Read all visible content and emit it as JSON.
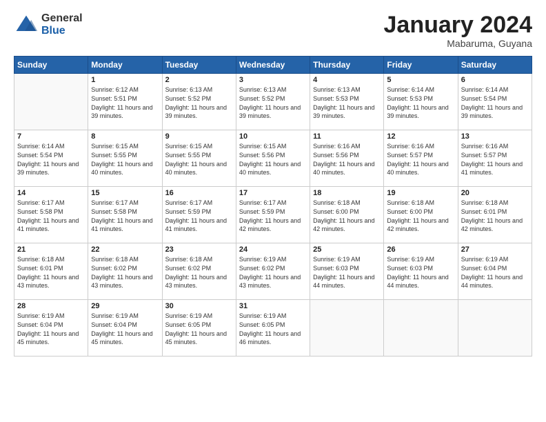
{
  "header": {
    "logo_general": "General",
    "logo_blue": "Blue",
    "month_title": "January 2024",
    "location": "Mabaruma, Guyana"
  },
  "days_of_week": [
    "Sunday",
    "Monday",
    "Tuesday",
    "Wednesday",
    "Thursday",
    "Friday",
    "Saturday"
  ],
  "weeks": [
    [
      {
        "day": "",
        "sunrise": "",
        "sunset": "",
        "daylight": ""
      },
      {
        "day": "1",
        "sunrise": "Sunrise: 6:12 AM",
        "sunset": "Sunset: 5:51 PM",
        "daylight": "Daylight: 11 hours and 39 minutes."
      },
      {
        "day": "2",
        "sunrise": "Sunrise: 6:13 AM",
        "sunset": "Sunset: 5:52 PM",
        "daylight": "Daylight: 11 hours and 39 minutes."
      },
      {
        "day": "3",
        "sunrise": "Sunrise: 6:13 AM",
        "sunset": "Sunset: 5:52 PM",
        "daylight": "Daylight: 11 hours and 39 minutes."
      },
      {
        "day": "4",
        "sunrise": "Sunrise: 6:13 AM",
        "sunset": "Sunset: 5:53 PM",
        "daylight": "Daylight: 11 hours and 39 minutes."
      },
      {
        "day": "5",
        "sunrise": "Sunrise: 6:14 AM",
        "sunset": "Sunset: 5:53 PM",
        "daylight": "Daylight: 11 hours and 39 minutes."
      },
      {
        "day": "6",
        "sunrise": "Sunrise: 6:14 AM",
        "sunset": "Sunset: 5:54 PM",
        "daylight": "Daylight: 11 hours and 39 minutes."
      }
    ],
    [
      {
        "day": "7",
        "sunrise": "Sunrise: 6:14 AM",
        "sunset": "Sunset: 5:54 PM",
        "daylight": "Daylight: 11 hours and 39 minutes."
      },
      {
        "day": "8",
        "sunrise": "Sunrise: 6:15 AM",
        "sunset": "Sunset: 5:55 PM",
        "daylight": "Daylight: 11 hours and 40 minutes."
      },
      {
        "day": "9",
        "sunrise": "Sunrise: 6:15 AM",
        "sunset": "Sunset: 5:55 PM",
        "daylight": "Daylight: 11 hours and 40 minutes."
      },
      {
        "day": "10",
        "sunrise": "Sunrise: 6:15 AM",
        "sunset": "Sunset: 5:56 PM",
        "daylight": "Daylight: 11 hours and 40 minutes."
      },
      {
        "day": "11",
        "sunrise": "Sunrise: 6:16 AM",
        "sunset": "Sunset: 5:56 PM",
        "daylight": "Daylight: 11 hours and 40 minutes."
      },
      {
        "day": "12",
        "sunrise": "Sunrise: 6:16 AM",
        "sunset": "Sunset: 5:57 PM",
        "daylight": "Daylight: 11 hours and 40 minutes."
      },
      {
        "day": "13",
        "sunrise": "Sunrise: 6:16 AM",
        "sunset": "Sunset: 5:57 PM",
        "daylight": "Daylight: 11 hours and 41 minutes."
      }
    ],
    [
      {
        "day": "14",
        "sunrise": "Sunrise: 6:17 AM",
        "sunset": "Sunset: 5:58 PM",
        "daylight": "Daylight: 11 hours and 41 minutes."
      },
      {
        "day": "15",
        "sunrise": "Sunrise: 6:17 AM",
        "sunset": "Sunset: 5:58 PM",
        "daylight": "Daylight: 11 hours and 41 minutes."
      },
      {
        "day": "16",
        "sunrise": "Sunrise: 6:17 AM",
        "sunset": "Sunset: 5:59 PM",
        "daylight": "Daylight: 11 hours and 41 minutes."
      },
      {
        "day": "17",
        "sunrise": "Sunrise: 6:17 AM",
        "sunset": "Sunset: 5:59 PM",
        "daylight": "Daylight: 11 hours and 42 minutes."
      },
      {
        "day": "18",
        "sunrise": "Sunrise: 6:18 AM",
        "sunset": "Sunset: 6:00 PM",
        "daylight": "Daylight: 11 hours and 42 minutes."
      },
      {
        "day": "19",
        "sunrise": "Sunrise: 6:18 AM",
        "sunset": "Sunset: 6:00 PM",
        "daylight": "Daylight: 11 hours and 42 minutes."
      },
      {
        "day": "20",
        "sunrise": "Sunrise: 6:18 AM",
        "sunset": "Sunset: 6:01 PM",
        "daylight": "Daylight: 11 hours and 42 minutes."
      }
    ],
    [
      {
        "day": "21",
        "sunrise": "Sunrise: 6:18 AM",
        "sunset": "Sunset: 6:01 PM",
        "daylight": "Daylight: 11 hours and 43 minutes."
      },
      {
        "day": "22",
        "sunrise": "Sunrise: 6:18 AM",
        "sunset": "Sunset: 6:02 PM",
        "daylight": "Daylight: 11 hours and 43 minutes."
      },
      {
        "day": "23",
        "sunrise": "Sunrise: 6:18 AM",
        "sunset": "Sunset: 6:02 PM",
        "daylight": "Daylight: 11 hours and 43 minutes."
      },
      {
        "day": "24",
        "sunrise": "Sunrise: 6:19 AM",
        "sunset": "Sunset: 6:02 PM",
        "daylight": "Daylight: 11 hours and 43 minutes."
      },
      {
        "day": "25",
        "sunrise": "Sunrise: 6:19 AM",
        "sunset": "Sunset: 6:03 PM",
        "daylight": "Daylight: 11 hours and 44 minutes."
      },
      {
        "day": "26",
        "sunrise": "Sunrise: 6:19 AM",
        "sunset": "Sunset: 6:03 PM",
        "daylight": "Daylight: 11 hours and 44 minutes."
      },
      {
        "day": "27",
        "sunrise": "Sunrise: 6:19 AM",
        "sunset": "Sunset: 6:04 PM",
        "daylight": "Daylight: 11 hours and 44 minutes."
      }
    ],
    [
      {
        "day": "28",
        "sunrise": "Sunrise: 6:19 AM",
        "sunset": "Sunset: 6:04 PM",
        "daylight": "Daylight: 11 hours and 45 minutes."
      },
      {
        "day": "29",
        "sunrise": "Sunrise: 6:19 AM",
        "sunset": "Sunset: 6:04 PM",
        "daylight": "Daylight: 11 hours and 45 minutes."
      },
      {
        "day": "30",
        "sunrise": "Sunrise: 6:19 AM",
        "sunset": "Sunset: 6:05 PM",
        "daylight": "Daylight: 11 hours and 45 minutes."
      },
      {
        "day": "31",
        "sunrise": "Sunrise: 6:19 AM",
        "sunset": "Sunset: 6:05 PM",
        "daylight": "Daylight: 11 hours and 46 minutes."
      },
      {
        "day": "",
        "sunrise": "",
        "sunset": "",
        "daylight": ""
      },
      {
        "day": "",
        "sunrise": "",
        "sunset": "",
        "daylight": ""
      },
      {
        "day": "",
        "sunrise": "",
        "sunset": "",
        "daylight": ""
      }
    ]
  ]
}
